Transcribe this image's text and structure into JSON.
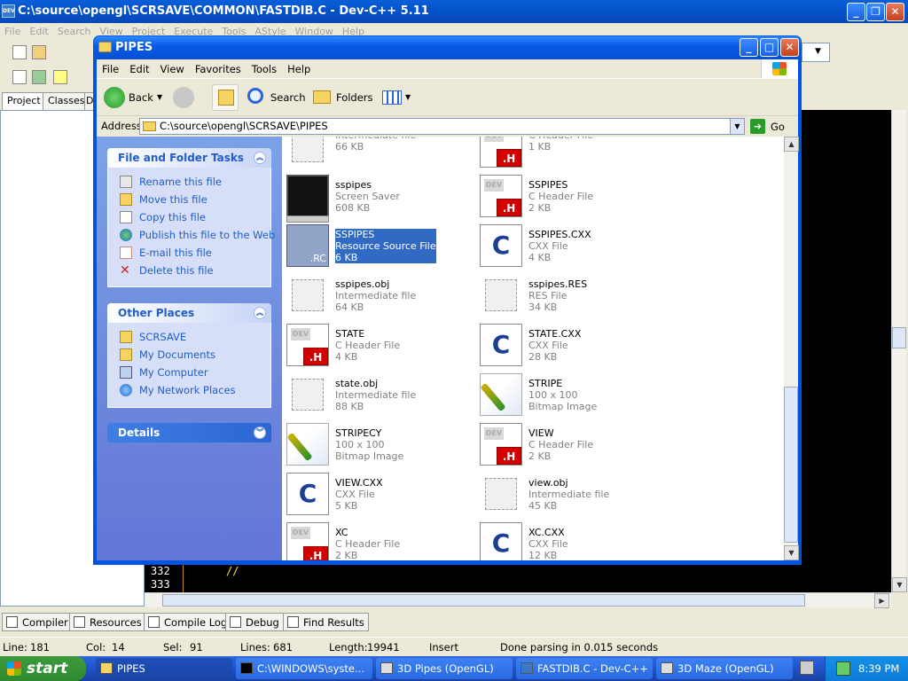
{
  "devcpp": {
    "title": "C:\\source\\opengl\\SCRSAVE\\COMMON\\FASTDIB.C - Dev-C++ 5.11",
    "menu": [
      "File",
      "Edit",
      "Search",
      "View",
      "Project",
      "Execute",
      "Tools",
      "AStyle",
      "Window",
      "Help"
    ],
    "side_tabs": [
      "Project",
      "Classes",
      "D"
    ],
    "line_numbers": [
      "332",
      "333"
    ],
    "code_comment": "//",
    "bottom_tabs": [
      "Compiler",
      "Resources",
      "Compile Log",
      "Debug",
      "Find Results"
    ],
    "status": {
      "line_label": "Line:",
      "line": "181",
      "col_label": "Col:",
      "col": "14",
      "sel_label": "Sel:",
      "sel": "91",
      "lines_label": "Lines:",
      "lines": "681",
      "length_label": "Length:",
      "length": "19941",
      "mode": "Insert",
      "message": "Done parsing in 0.015 seconds"
    }
  },
  "explorer": {
    "title": "PIPES",
    "menu": [
      "File",
      "Edit",
      "View",
      "Favorites",
      "Tools",
      "Help"
    ],
    "toolbar": {
      "back": "Back",
      "search": "Search",
      "folders": "Folders"
    },
    "address_label": "Address",
    "address": "C:\\source\\opengl\\SCRSAVE\\PIPES",
    "go": "Go",
    "tasks": {
      "file_folder_title": "File and Folder Tasks",
      "file_folder_items": [
        "Rename this file",
        "Move this file",
        "Copy this file",
        "Publish this file to the Web",
        "E-mail this file",
        "Delete this file"
      ],
      "other_places_title": "Other Places",
      "other_places_items": [
        "SCRSAVE",
        "My Documents",
        "My Computer",
        "My Network Places"
      ],
      "details_title": "Details"
    },
    "files": [
      {
        "name": "",
        "type": "Intermediate file",
        "size": "66 KB",
        "icon": "obj"
      },
      {
        "name": "",
        "type": "C Header File",
        "size": "1 KB",
        "icon": "h"
      },
      {
        "name": "sspipes",
        "type": "Screen Saver",
        "size": "608 KB",
        "icon": "scr"
      },
      {
        "name": "SSPIPES",
        "type": "C Header File",
        "size": "2 KB",
        "icon": "h"
      },
      {
        "name": "SSPIPES",
        "type": "Resource Source File",
        "size": "6 KB",
        "icon": "rc",
        "selected": true
      },
      {
        "name": "SSPIPES.CXX",
        "type": "CXX File",
        "size": "4 KB",
        "icon": "c"
      },
      {
        "name": "sspipes.obj",
        "type": "Intermediate file",
        "size": "64 KB",
        "icon": "obj"
      },
      {
        "name": "sspipes.RES",
        "type": "RES File",
        "size": "34 KB",
        "icon": "obj"
      },
      {
        "name": "STATE",
        "type": "C Header File",
        "size": "4 KB",
        "icon": "h"
      },
      {
        "name": "STATE.CXX",
        "type": "CXX File",
        "size": "28 KB",
        "icon": "c"
      },
      {
        "name": "state.obj",
        "type": "Intermediate file",
        "size": "88 KB",
        "icon": "obj"
      },
      {
        "name": "STRIPE",
        "type": "100 x 100",
        "size": "Bitmap Image",
        "icon": "bmp"
      },
      {
        "name": "STRIPECY",
        "type": "100 x 100",
        "size": "Bitmap Image",
        "icon": "bmp"
      },
      {
        "name": "VIEW",
        "type": "C Header File",
        "size": "2 KB",
        "icon": "h"
      },
      {
        "name": "VIEW.CXX",
        "type": "CXX File",
        "size": "5 KB",
        "icon": "c"
      },
      {
        "name": "view.obj",
        "type": "Intermediate file",
        "size": "45 KB",
        "icon": "obj"
      },
      {
        "name": "XC",
        "type": "C Header File",
        "size": "2 KB",
        "icon": "h"
      },
      {
        "name": "XC.CXX",
        "type": "CXX File",
        "size": "12 KB",
        "icon": "c"
      }
    ]
  },
  "taskbar": {
    "start": "start",
    "items": [
      "PIPES",
      "C:\\WINDOWS\\syste...",
      "3D Pipes (OpenGL)",
      "FASTDIB.C - Dev-C++",
      "3D Maze (OpenGL)"
    ],
    "clock": "8:39 PM"
  },
  "colors": {
    "xp_blue": "#0054e3",
    "selection": "#316ac5",
    "taskpane_link": "#215dc6",
    "h_badge": "#d40000"
  }
}
